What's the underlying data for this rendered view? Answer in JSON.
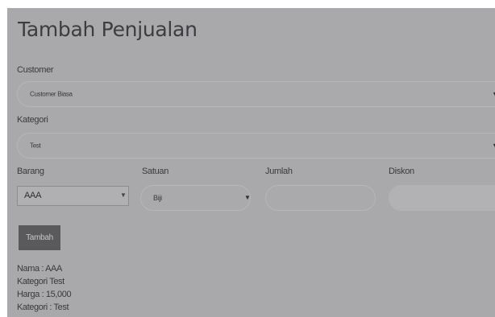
{
  "header": {
    "title": "Tambah Penjualan"
  },
  "customer": {
    "label": "Customer",
    "value": "Customer Biasa"
  },
  "kategori": {
    "label": "Kategori",
    "value": "Test"
  },
  "columns": {
    "barang": "Barang",
    "satuan": "Satuan",
    "jumlah": "Jumlah",
    "diskon": "Diskon"
  },
  "barang": {
    "value": "AAA"
  },
  "satuan": {
    "value": "Biji"
  },
  "jumlah": {
    "value": ""
  },
  "diskon": {
    "value": ""
  },
  "actions": {
    "add_label": "Tambah"
  },
  "info": [
    "Nama : AAA",
    "Kategori Test",
    "Harga : 15,000",
    "Kategori : Test"
  ],
  "icons": {
    "dropdown": "caret-down-icon"
  }
}
